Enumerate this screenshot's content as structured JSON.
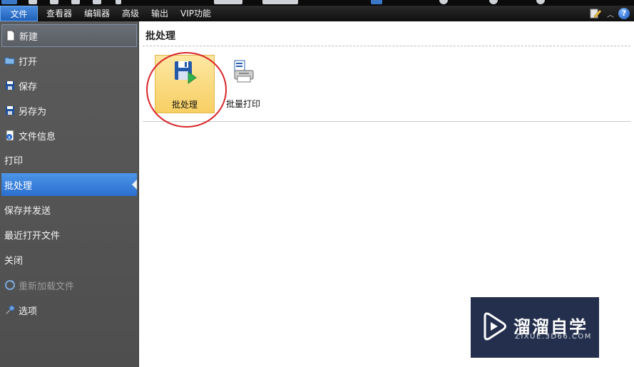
{
  "menubar": {
    "items": [
      "文件",
      "查看器",
      "编辑器",
      "高级",
      "输出",
      "VIP功能"
    ],
    "help_icon_text": "?"
  },
  "sidebar": {
    "items": [
      {
        "label": "新建",
        "icon": "new-doc-icon"
      },
      {
        "label": "打开",
        "icon": "folder-open-icon"
      },
      {
        "label": "保存",
        "icon": "save-icon"
      },
      {
        "label": "另存为",
        "icon": "save-as-icon"
      },
      {
        "label": "文件信息",
        "icon": "info-icon"
      },
      {
        "label": "打印",
        "icon": ""
      },
      {
        "label": "批处理",
        "icon": "",
        "selected": true
      },
      {
        "label": "保存并发送",
        "icon": ""
      },
      {
        "label": "最近打开文件",
        "icon": ""
      },
      {
        "label": "关闭",
        "icon": ""
      },
      {
        "label": "重新加载文件",
        "icon": "reload-icon",
        "disabled": true
      },
      {
        "label": "选项",
        "icon": "wrench-icon"
      }
    ]
  },
  "main": {
    "title": "批处理",
    "tiles": [
      {
        "label": "批处理",
        "icon": "batch-save-icon",
        "selected": true
      },
      {
        "label": "批量打印",
        "icon": "batch-print-icon"
      }
    ]
  },
  "watermark": {
    "title": "溜溜自学",
    "subtitle": "ZIXUE.3D66.COM"
  },
  "colors": {
    "accent": "#2c6fcf",
    "highlight": "#d9262a",
    "tile_selected": "#f7cf63"
  }
}
